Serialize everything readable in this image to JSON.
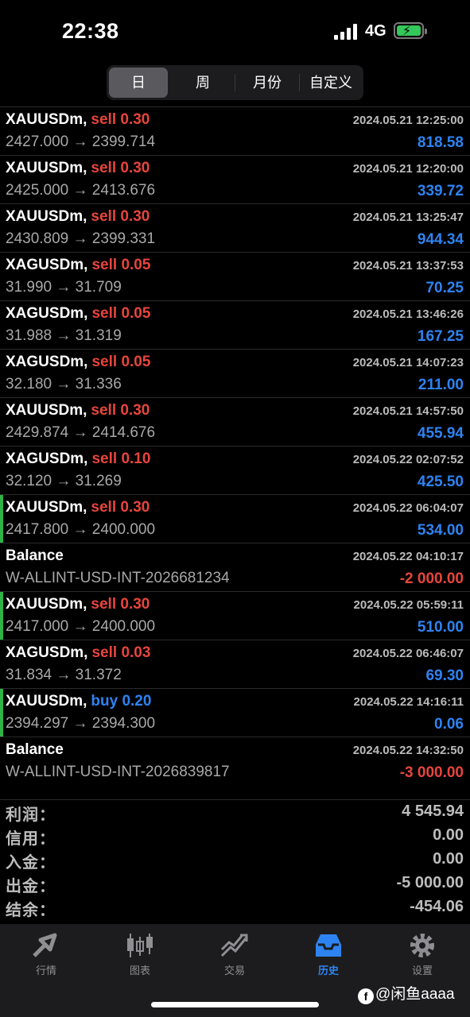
{
  "status_bar": {
    "time": "22:38",
    "network": "4G"
  },
  "segments": [
    {
      "label": "日",
      "active": true
    },
    {
      "label": "周",
      "active": false
    },
    {
      "label": "月份",
      "active": false
    },
    {
      "label": "自定义",
      "active": false
    }
  ],
  "deals": [
    {
      "symbol": "XAUUSDm,",
      "side": "sell 0.30",
      "date": "2024.05.21 12:25:00",
      "prices": "2427.000 → 2399.714",
      "profit": "818.58"
    },
    {
      "symbol": "XAUUSDm,",
      "side": "sell 0.30",
      "date": "2024.05.21 12:20:00",
      "prices": "2425.000 → 2413.676",
      "profit": "339.72"
    },
    {
      "symbol": "XAUUSDm,",
      "side": "sell 0.30",
      "date": "2024.05.21 13:25:47",
      "prices": "2430.809 → 2399.331",
      "profit": "944.34"
    },
    {
      "symbol": "XAGUSDm,",
      "side": "sell 0.05",
      "date": "2024.05.21 13:37:53",
      "prices": "31.990 → 31.709",
      "profit": "70.25"
    },
    {
      "symbol": "XAGUSDm,",
      "side": "sell 0.05",
      "date": "2024.05.21 13:46:26",
      "prices": "31.988 → 31.319",
      "profit": "167.25"
    },
    {
      "symbol": "XAGUSDm,",
      "side": "sell 0.05",
      "date": "2024.05.21 14:07:23",
      "prices": "32.180 → 31.336",
      "profit": "211.00"
    },
    {
      "symbol": "XAUUSDm,",
      "side": "sell 0.30",
      "date": "2024.05.21 14:57:50",
      "prices": "2429.874 → 2414.676",
      "profit": "455.94"
    },
    {
      "symbol": "XAGUSDm,",
      "side": "sell 0.10",
      "date": "2024.05.22 02:07:52",
      "prices": "32.120 → 31.269",
      "profit": "425.50"
    },
    {
      "symbol": "XAUUSDm,",
      "side": "sell 0.30",
      "date": "2024.05.22 06:04:07",
      "prices": "2417.800 → 2400.000",
      "profit": "534.00"
    },
    {
      "symbol": "Balance",
      "side": "",
      "date": "2024.05.22 04:10:17",
      "prices": "W-ALLINT-USD-INT-2026681234",
      "profit": "-2 000.00"
    },
    {
      "symbol": "XAUUSDm,",
      "side": "sell 0.30",
      "date": "2024.05.22 05:59:11",
      "prices": "2417.000 → 2400.000",
      "profit": "510.00"
    },
    {
      "symbol": "XAGUSDm,",
      "side": "sell 0.03",
      "date": "2024.05.22 06:46:07",
      "prices": "31.834 → 31.372",
      "profit": "69.30"
    },
    {
      "symbol": "XAUUSDm,",
      "side": "buy 0.20",
      "date": "2024.05.22 14:16:11",
      "prices": "2394.297 → 2394.300",
      "profit": "0.06"
    },
    {
      "symbol": "Balance",
      "side": "",
      "date": "2024.05.22 14:32:50",
      "prices": "W-ALLINT-USD-INT-2026839817",
      "profit": "-3 000.00"
    }
  ],
  "summary": [
    {
      "label": "利润：",
      "value": "4 545.94"
    },
    {
      "label": "信用：",
      "value": "0.00"
    },
    {
      "label": "入金：",
      "value": "0.00"
    },
    {
      "label": "出金：",
      "value": "-5 000.00"
    },
    {
      "label": "结余：",
      "value": "-454.06"
    }
  ],
  "tabs": [
    {
      "label": "行情",
      "icon": "quotes-icon",
      "active": false
    },
    {
      "label": "图表",
      "icon": "chart-icon",
      "active": false
    },
    {
      "label": "交易",
      "icon": "trade-icon",
      "active": false
    },
    {
      "label": "历史",
      "icon": "history-icon",
      "active": true
    },
    {
      "label": "设置",
      "icon": "settings-icon",
      "active": false
    }
  ],
  "watermark": "@闲鱼aaaa",
  "colors": {
    "sell": "#e8453c",
    "buy": "#2e83f2",
    "profit_positive": "#2e83f2",
    "profit_negative": "#e8453c",
    "highlight_bar": "#2fb344",
    "tab_active": "#2e83f2"
  }
}
